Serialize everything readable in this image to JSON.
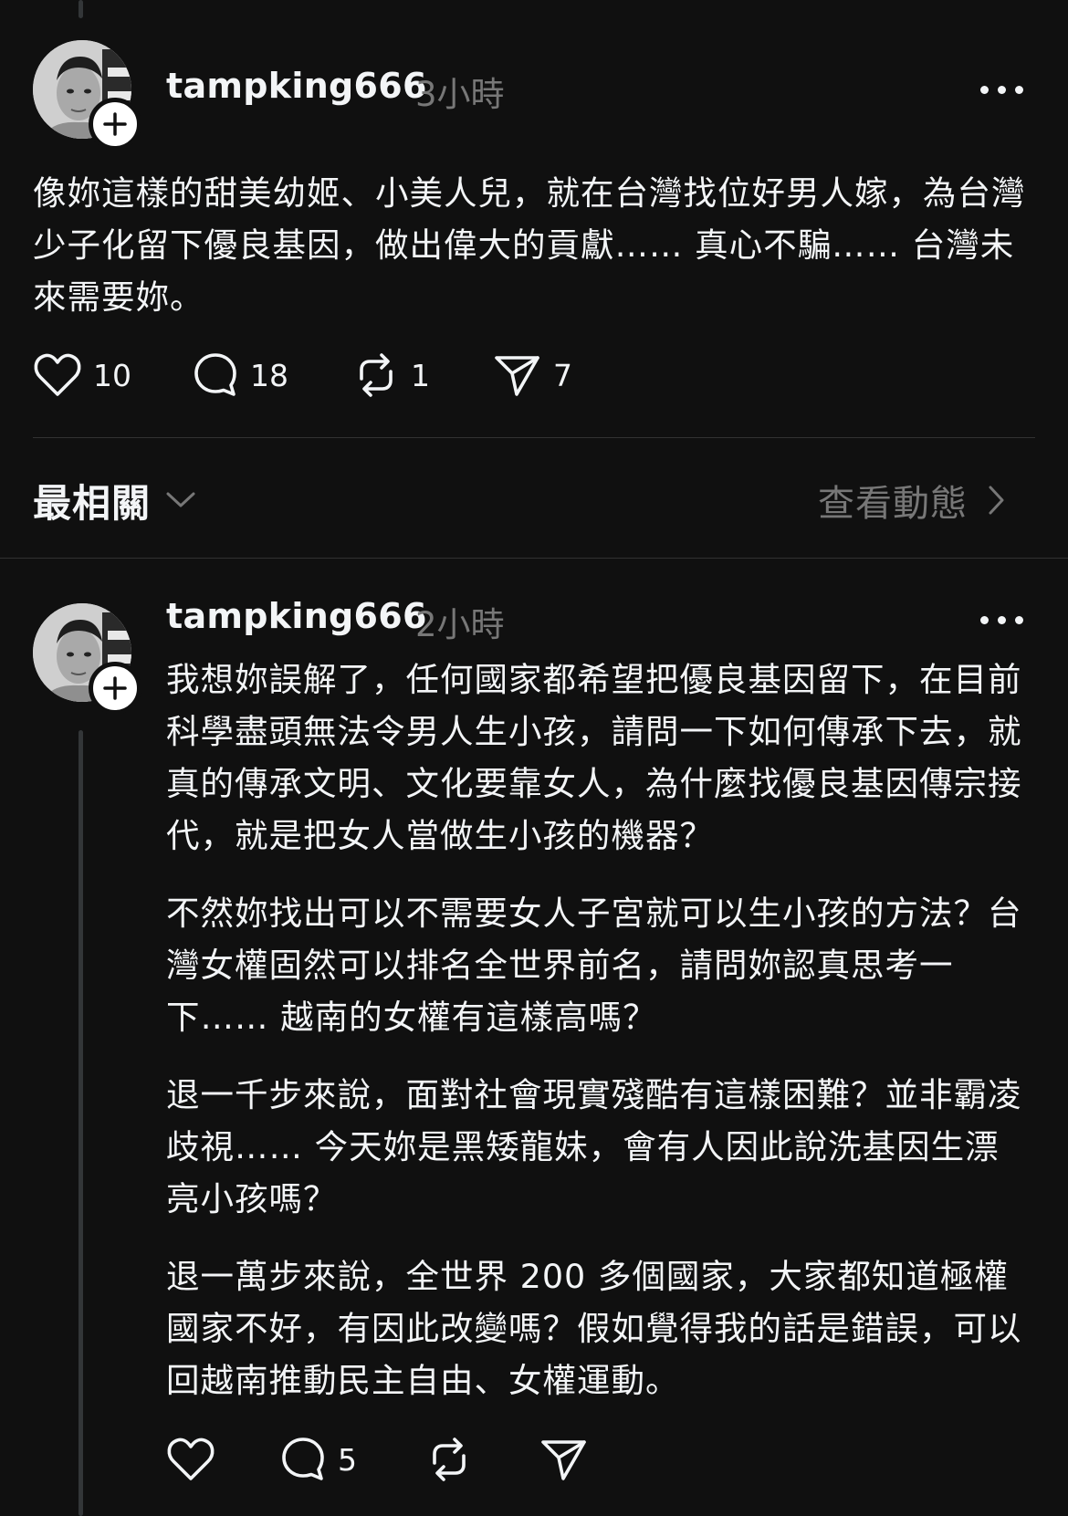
{
  "top_post": {
    "username": "tampking666",
    "time": "3小時",
    "text": "像妳這樣的甜美幼姬、小美人兒，就在台灣找位好男人嫁，為台灣少子化留下優良基因，做出偉大的貢獻…… 真心不騙…… 台灣未來需要妳。",
    "actions": {
      "like_count": "10",
      "comment_count": "18",
      "repost_count": "1",
      "share_count": "7"
    }
  },
  "sort_bar": {
    "sort_label": "最相關",
    "activity_label": "查看動態"
  },
  "reply": {
    "username": "tampking666",
    "time": "2小時",
    "paragraphs": [
      "我想妳誤解了，任何國家都希望把優良基因留下，在目前科學盡頭無法令男人生小孩，請問一下如何傳承下去，就真的傳承文明、文化要靠女人，為什麼找優良基因傳宗接代，就是把女人當做生小孩的機器？",
      "不然妳找出可以不需要女人子宮就可以生小孩的方法？台灣女權固然可以排名全世界前名，請問妳認真思考一下…… 越南的女權有這樣高嗎？",
      "退一千步來說，面對社會現實殘酷有這樣困難？並非霸凌歧視…… 今天妳是黑矮龍妹，會有人因此說洗基因生漂亮小孩嗎？",
      "退一萬步來說，全世界 200 多個國家，大家都知道極權國家不好，有因此改變嗎？假如覺得我的話是錯誤，可以回越南推動民主自由、女權運動。"
    ],
    "actions": {
      "comment_count": "5"
    }
  },
  "icons": {
    "like": "heart-icon",
    "comment": "comment-bubble-icon",
    "repost": "repost-icon",
    "share": "send-icon",
    "follow": "plus-icon",
    "more": "more-dots-icon",
    "sort": "chevron-down-icon",
    "activity": "chevron-right-icon"
  },
  "colors": {
    "background": "#101010",
    "text_primary": "#f3f5f7",
    "text_secondary": "#777777",
    "divider": "#323232"
  }
}
